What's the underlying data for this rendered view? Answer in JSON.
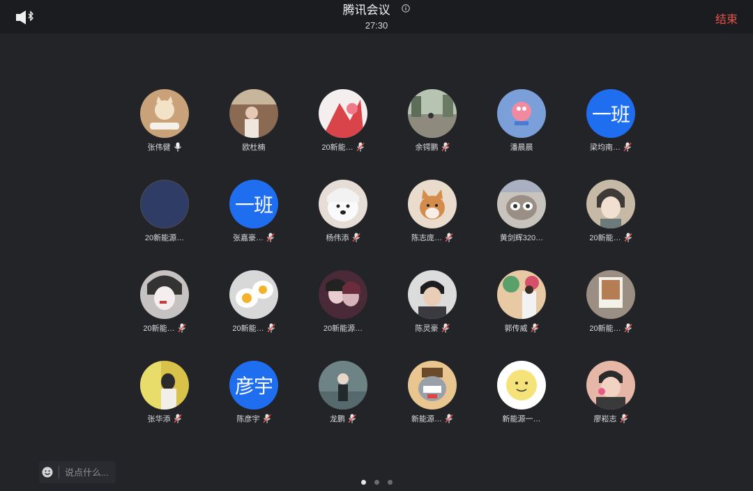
{
  "header": {
    "title": "腾讯会议",
    "timer": "27:30",
    "end_label": "结束"
  },
  "chat": {
    "placeholder": "说点什么..."
  },
  "participants": [
    {
      "name": "张伟健",
      "mic": "on",
      "avatar": "cat-photo",
      "color": "#caa27a"
    },
    {
      "name": "欧杜楠",
      "mic": "none",
      "avatar": "person-photo",
      "color": "#8a6a52"
    },
    {
      "name": "20新能…",
      "mic": "muted",
      "avatar": "red-art-photo",
      "color": "#d9434a"
    },
    {
      "name": "余锷鹏",
      "mic": "muted",
      "avatar": "street-photo",
      "color": "#8f8a7e"
    },
    {
      "name": "潘晨晨",
      "mic": "none",
      "avatar": "starfish-cartoon",
      "color": "#7b9fd9"
    },
    {
      "name": "梁均南…",
      "mic": "muted",
      "avatar": "text",
      "avatar_text": "一班",
      "color": "#1f6ef0"
    },
    {
      "name": "20新能源…",
      "mic": "none",
      "avatar": "plain",
      "color": "#2f3d66"
    },
    {
      "name": "张嘉豪…",
      "mic": "muted",
      "avatar": "text",
      "avatar_text": "一班",
      "color": "#1f6ef0"
    },
    {
      "name": "杨伟添",
      "mic": "muted",
      "avatar": "dog-photo",
      "color": "#e6ded6"
    },
    {
      "name": "陈志庞…",
      "mic": "muted",
      "avatar": "shiba-photo",
      "color": "#e9dccd"
    },
    {
      "name": "黄剑辉320…",
      "mic": "none",
      "avatar": "raccoon-cartoon",
      "color": "#c9c3bd"
    },
    {
      "name": "20新能…",
      "mic": "muted",
      "avatar": "anime-boy",
      "color": "#6d7a7a"
    },
    {
      "name": "20新能…",
      "mic": "muted",
      "avatar": "anime-drawing",
      "color": "#c7c2c2"
    },
    {
      "name": "20新能…",
      "mic": "muted",
      "avatar": "eggs-photo",
      "color": "#d8d8d8"
    },
    {
      "name": "20新能源…",
      "mic": "none",
      "avatar": "anime-dark",
      "color": "#4a2a36"
    },
    {
      "name": "陈灵豪",
      "mic": "muted",
      "avatar": "boy-photo",
      "color": "#3a3a40"
    },
    {
      "name": "郭传威",
      "mic": "muted",
      "avatar": "painting-photo",
      "color": "#c98f6b"
    },
    {
      "name": "20新能…",
      "mic": "muted",
      "avatar": "polaroid-photo",
      "color": "#9b8e83"
    },
    {
      "name": "张华添",
      "mic": "muted",
      "avatar": "yellow-photo",
      "color": "#d9c24a"
    },
    {
      "name": "陈彦宇",
      "mic": "muted",
      "avatar": "text",
      "avatar_text": "彦宇",
      "color": "#1f6ef0"
    },
    {
      "name": "龙鹏",
      "mic": "muted",
      "avatar": "figure-photo",
      "color": "#6e8386"
    },
    {
      "name": "新能源…",
      "mic": "muted",
      "avatar": "cartoon-animal",
      "color": "#e9c68f"
    },
    {
      "name": "新能源一…",
      "mic": "none",
      "avatar": "sun-cartoon",
      "color": "#f5e37a"
    },
    {
      "name": "廖崧志",
      "mic": "muted",
      "avatar": "cartoon-man",
      "color": "#e6b6a6"
    }
  ],
  "pager": {
    "count": 3,
    "active": 0
  }
}
